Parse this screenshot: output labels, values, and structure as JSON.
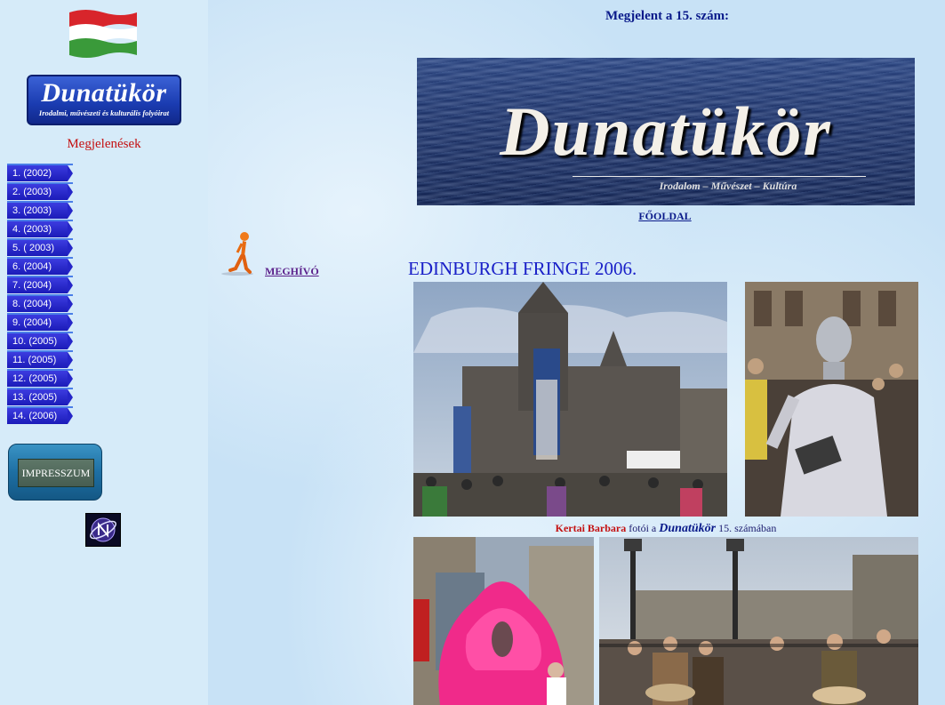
{
  "sidebar": {
    "logo": {
      "title": "Dunatükör",
      "subtitle": "Irodalmi, művészeti és kulturális folyóirat"
    },
    "appearances_title": "Megjelenések",
    "issues": [
      "1. (2002)",
      "2. (2003)",
      "3. (2003)",
      "4. (2003)",
      "5. ( 2003)",
      "6. (2004)",
      "7. (2004)",
      "8. (2004)",
      "9. (2004)",
      "10. (2005)",
      "11. (2005)",
      "12. (2005)",
      "13. (2005)",
      "14. (2006)"
    ],
    "impressum_label": "IMPRESSZUM"
  },
  "main": {
    "published_text": "Megjelent a 15. szám:",
    "banner": {
      "title": "Dunatükör",
      "subtitle": "Irodalom – Művészet – Kultúra"
    },
    "home_link": "FŐOLDAL",
    "invite_link": "MEGHÍVÓ",
    "event_title": "EDINBURGH FRINGE 2006.",
    "caption": {
      "name": "Kertai Barbara",
      "middle": "fotói a",
      "magazine": "Dunatükör",
      "end": "15. számában"
    }
  },
  "colors": {
    "sidebar_bg": "#d6ebf9",
    "main_bg": "#c8e2f6",
    "accent_red": "#c41010",
    "nav_blue": "#1b1bb8",
    "title_blue": "#1a20c8"
  },
  "icons": [
    "hungarian-flag-icon",
    "walking-man-icon",
    "badge-icon"
  ]
}
